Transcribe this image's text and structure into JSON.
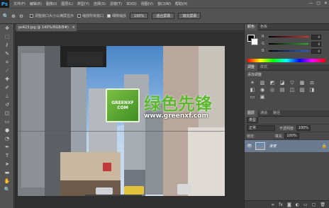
{
  "app": {
    "logo": "Ps",
    "menu": [
      "文件(F)",
      "编辑(E)",
      "图像(I)",
      "图层(L)",
      "类型(Y)",
      "选择(S)",
      "滤镜(T)",
      "3D(D)",
      "视图(V)",
      "窗口(W)",
      "帮助(H)"
    ],
    "window_controls": [
      "—",
      "▢",
      "✕"
    ]
  },
  "options": {
    "icons": [
      "magnifier-icon",
      "zoom-in-icon",
      "zoom-out-icon"
    ],
    "resize_windows": "调整窗口大小以满屏显示",
    "zoom_all": "缩放所有窗口",
    "scrubby_zoom": "细微缩放",
    "btn_100": "100%",
    "btn_fit": "适合屏幕",
    "btn_fill": "填充屏幕"
  },
  "document": {
    "tab_title": "ps423.jpg @ 140%(RGB/8#)",
    "close": "×"
  },
  "watermark": {
    "cn_text": "绿色先锋",
    "url": "www.greenxf.com",
    "logo_top": "GREENXF",
    "logo_bottom": "COM"
  },
  "panels": {
    "color": {
      "tabs": [
        "颜色",
        "色板"
      ],
      "channels": [
        {
          "label": "R",
          "value": "0",
          "color": "#e03030"
        },
        {
          "label": "G",
          "value": "0",
          "color": "#30b030"
        },
        {
          "label": "B",
          "value": "0",
          "color": "#3060e0"
        }
      ]
    },
    "adjust": {
      "tabs": [
        "调整",
        "样式"
      ],
      "heading": "添加调整"
    },
    "layers": {
      "tabs": [
        "图层",
        "通道",
        "路径"
      ],
      "kind": "类型",
      "blend": "正常",
      "opacity_label": "不透明度:",
      "opacity": "100%",
      "lock_label": "锁定:",
      "fill_label": "填充:",
      "fill": "100%",
      "layer_name": "背景"
    }
  }
}
